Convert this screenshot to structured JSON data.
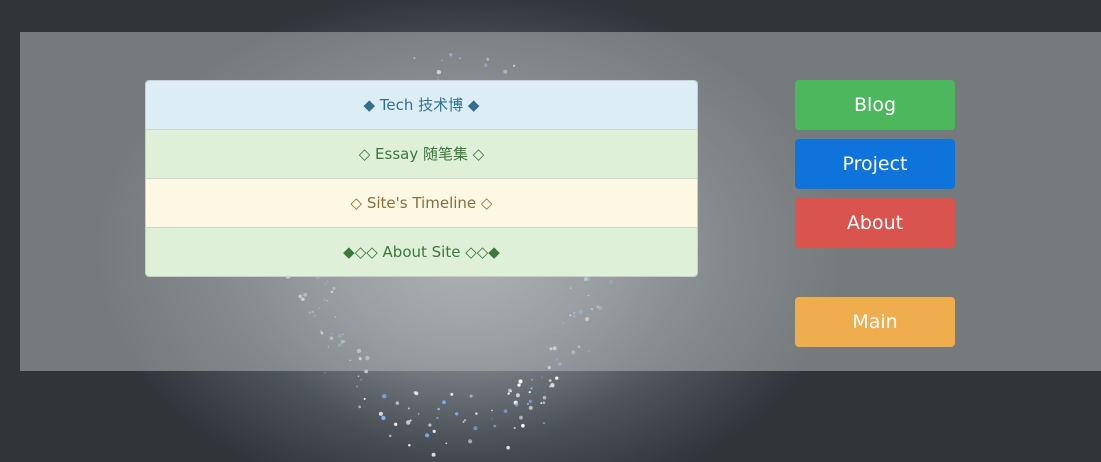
{
  "nav_list": {
    "items": [
      {
        "label": "◆ Tech 技术博 ◆",
        "variant": "info"
      },
      {
        "label": "◇ Essay 随笔集 ◇",
        "variant": "success"
      },
      {
        "label": "◇ Site's Timeline ◇",
        "variant": "warning"
      },
      {
        "label": "◆◇◇ About Site ◇◇◆",
        "variant": "success"
      }
    ]
  },
  "buttons": {
    "blog": "Blog",
    "project": "Project",
    "about": "About",
    "main": "Main"
  },
  "colors": {
    "blog": "#4cb75d",
    "project": "#0e74db",
    "about": "#d9534f",
    "main": "#f0ad4e",
    "info_bg": "#dcedf6",
    "success_bg": "#dff0d8",
    "warning_bg": "#fcf8e3"
  }
}
